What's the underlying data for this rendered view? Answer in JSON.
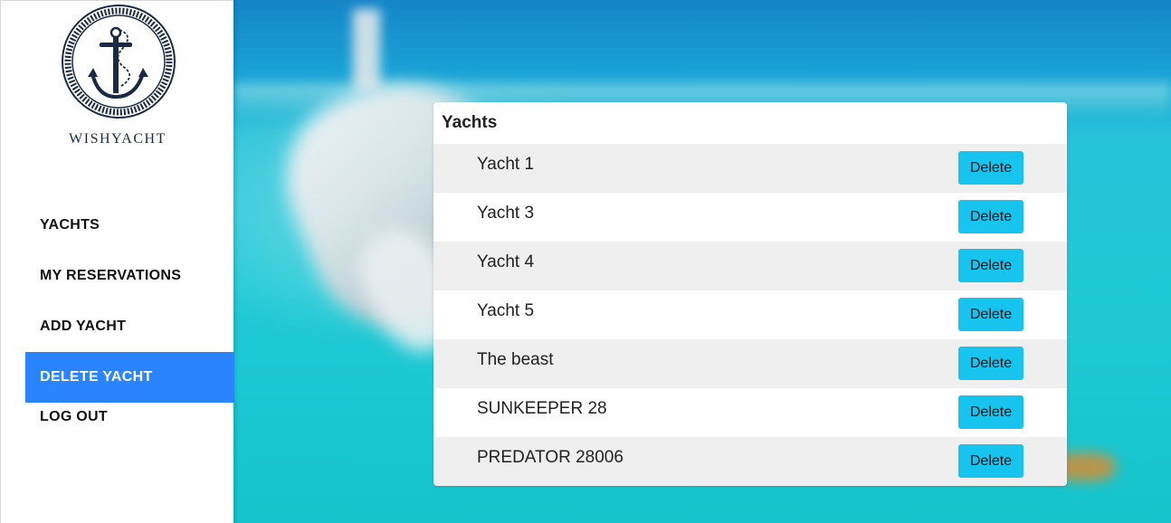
{
  "sidebar": {
    "brand": "WISHYACHT",
    "items": [
      {
        "label": "YACHTS",
        "active": false
      },
      {
        "label": "MY RESERVATIONS",
        "active": false
      },
      {
        "label": "ADD YACHT",
        "active": false
      },
      {
        "label": "DELETE YACHT",
        "active": true
      },
      {
        "label": "LOG OUT",
        "active": false
      }
    ],
    "active_color": "#2a84ff"
  },
  "panel": {
    "title": "Yachts",
    "rows": [
      {
        "name": "Yacht 1",
        "action": "Delete"
      },
      {
        "name": "Yacht 3",
        "action": "Delete"
      },
      {
        "name": "Yacht 4",
        "action": "Delete"
      },
      {
        "name": "Yacht 5",
        "action": "Delete"
      },
      {
        "name": "The beast",
        "action": "Delete"
      },
      {
        "name": "SUNKEEPER 28",
        "action": "Delete"
      },
      {
        "name": "PREDATOR 28006",
        "action": "Delete"
      }
    ],
    "button_color": "#16c4ee"
  },
  "icons": {
    "logo": "anchor-rope-icon"
  }
}
